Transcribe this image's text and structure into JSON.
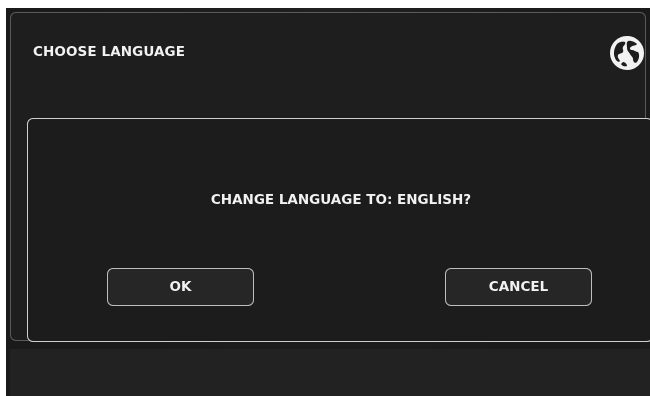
{
  "header": {
    "title": "CHOOSE LANGUAGE",
    "icon": "globe-icon"
  },
  "dialog": {
    "message": "CHANGE LANGUAGE TO: ENGLISH?",
    "ok_label": "OK",
    "cancel_label": "CANCEL"
  },
  "colors": {
    "background": "#1d1d1d",
    "text": "#f2f2f2",
    "border": "#cfcfcf"
  }
}
